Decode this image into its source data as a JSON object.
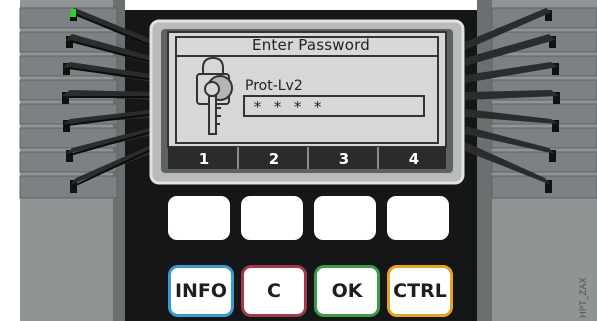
{
  "screen": {
    "title": "Enter Password",
    "level_label": "Prot-Lv2",
    "password_mask": "* * * *",
    "softkeys": [
      "1",
      "2",
      "3",
      "4"
    ]
  },
  "keys": {
    "info": {
      "label": "INFO",
      "color": "#3b9ad0"
    },
    "c": {
      "label": "C",
      "color": "#a33a4a"
    },
    "ok": {
      "label": "OK",
      "color": "#3e9a4a"
    },
    "ctrl": {
      "label": "CTRL",
      "color": "#e6a525"
    }
  },
  "watermark": "HPT_ZAX",
  "icons": {
    "password": "key-lock-icon",
    "status_led": "led-indicator"
  },
  "colors": {
    "panel_dark": "#141618",
    "side_gray": "#8e9394",
    "lcd_background": "#d7d7d7",
    "softkey_bar": "#2b2b2b",
    "led_green": "#33cc33"
  }
}
